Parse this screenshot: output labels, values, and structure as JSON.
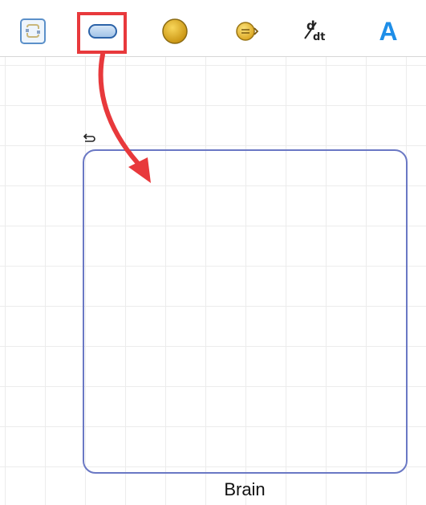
{
  "toolbar": {
    "tools": [
      {
        "name": "selection-tool",
        "icon": "group-frame-icon"
      },
      {
        "name": "stock-tool",
        "icon": "stock-rounded-rect-icon",
        "selected": true
      },
      {
        "name": "auxiliary-tool",
        "icon": "gold-circle-icon"
      },
      {
        "name": "flow-tool",
        "icon": "flow-valve-icon"
      },
      {
        "name": "derivative-tool",
        "icon": "ddt-icon",
        "label_num": "d",
        "label_den": "dt"
      },
      {
        "name": "text-tool",
        "icon": "text-A-icon",
        "label": "A"
      }
    ]
  },
  "canvas": {
    "stock": {
      "label": "Brain",
      "border_color": "#6a78c4"
    },
    "annotation": {
      "color": "#e8393c"
    }
  }
}
